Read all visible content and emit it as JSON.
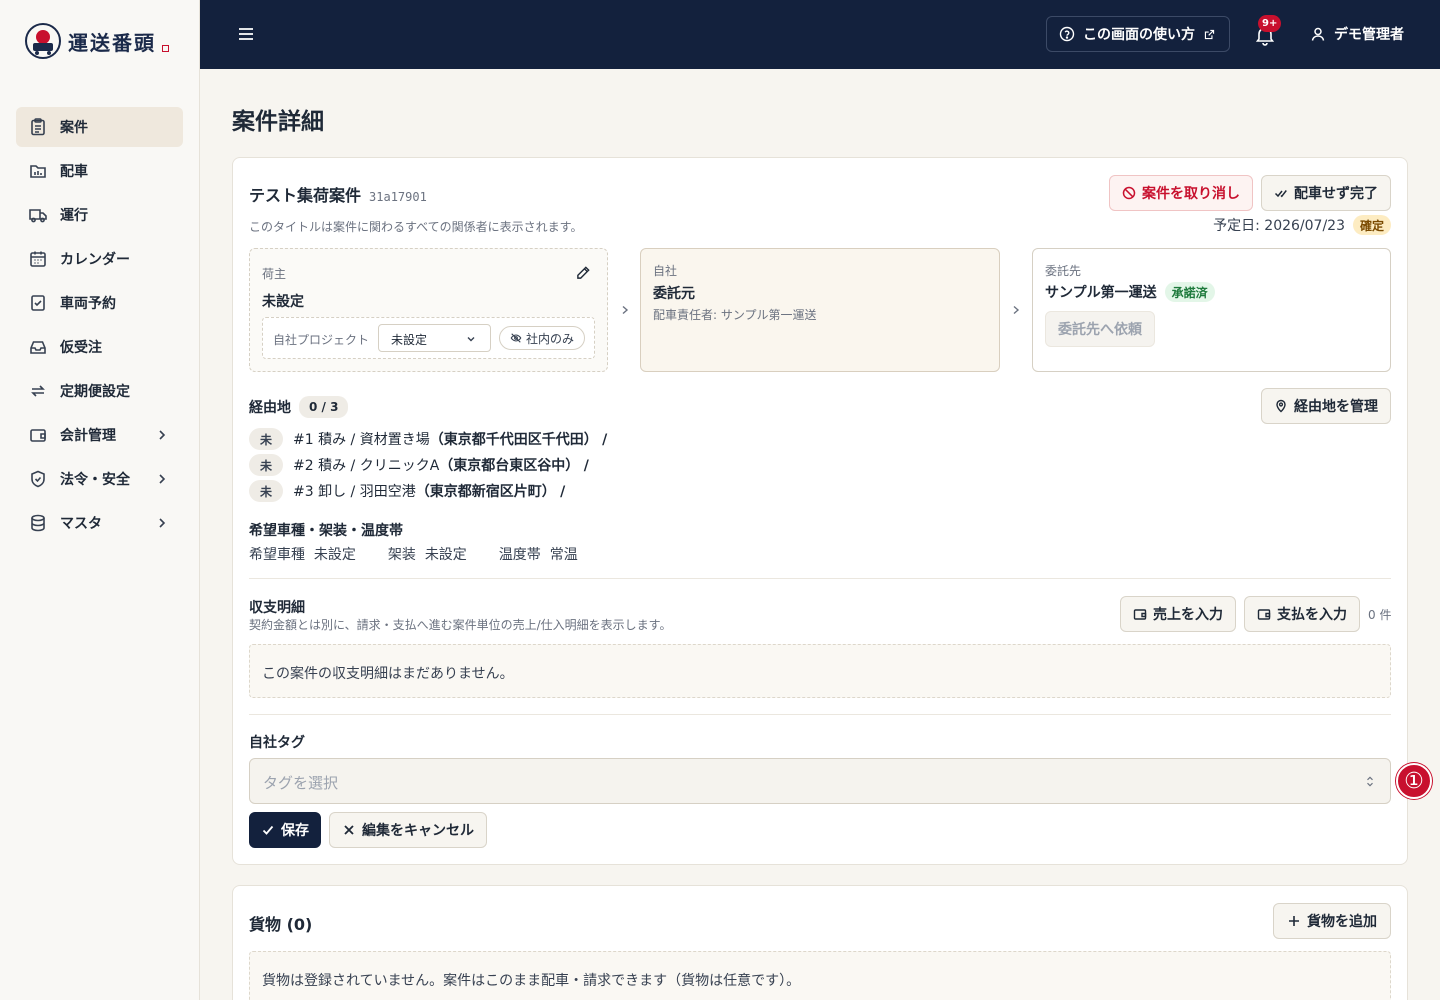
{
  "brand": {
    "name": "運送番頭",
    "colors": {
      "navy": "#13213d",
      "accent_red": "#c8102e"
    }
  },
  "sidebar": {
    "items": [
      {
        "label": "案件",
        "icon": "clipboard-icon",
        "active": true
      },
      {
        "label": "配車",
        "icon": "dispatch-board-icon"
      },
      {
        "label": "運行",
        "icon": "truck-icon"
      },
      {
        "label": "カレンダー",
        "icon": "calendar-icon"
      },
      {
        "label": "車両予約",
        "icon": "reservation-icon"
      },
      {
        "label": "仮受注",
        "icon": "inbox-icon"
      },
      {
        "label": "定期便設定",
        "icon": "repeat-icon"
      },
      {
        "label": "会計管理",
        "icon": "wallet-icon",
        "expandable": true
      },
      {
        "label": "法令・安全",
        "icon": "shield-icon",
        "expandable": true
      },
      {
        "label": "マスタ",
        "icon": "database-icon",
        "expandable": true
      }
    ]
  },
  "header": {
    "help_label": "この画面の使い方",
    "notification_count": "9+",
    "user_name": "デモ管理者"
  },
  "page": {
    "title": "案件詳細"
  },
  "case": {
    "title": "テスト集荷案件",
    "id": "31a17901",
    "title_note": "このタイトルは案件に関わるすべての関係者に表示されます。",
    "cancel_label": "案件を取り消し",
    "complete_label": "配車せず完了",
    "scheduled_label": "予定日: 2026/07/23",
    "status_label": "確定",
    "shipper": {
      "label": "荷主",
      "value": "未設定",
      "project_label": "自社プロジェクト",
      "project_value": "未設定",
      "internal_label": "社内のみ"
    },
    "own": {
      "label": "自社",
      "value": "委託元",
      "manager": "配車責任者: サンプル第一運送"
    },
    "contractor": {
      "label": "委託先",
      "value": "サンプル第一運送",
      "status": "承諾済",
      "request_label": "委託先へ依頼"
    },
    "stops": {
      "label": "経由地",
      "count": "0 / 3",
      "manage_label": "経由地を管理",
      "items": [
        {
          "status": "未",
          "text": "#1 積み / 資材置き場",
          "address": "（東京都千代田区千代田）",
          "suffix": "/"
        },
        {
          "status": "未",
          "text": "#2 積み / クリニックA",
          "address": "（東京都台東区谷中）",
          "suffix": "/"
        },
        {
          "status": "未",
          "text": "#3 卸し / 羽田空港",
          "address": "（東京都新宿区片町）",
          "suffix": "/"
        }
      ]
    },
    "vehicle": {
      "label": "希望車種・架装・温度帯",
      "type_label": "希望車種",
      "type_value": "未設定",
      "body_label": "架装",
      "body_value": "未設定",
      "temp_label": "温度帯",
      "temp_value": "常温"
    },
    "ledger": {
      "label": "収支明細",
      "note": "契約金額とは別に、請求・支払へ進む案件単位の売上/仕入明細を表示します。",
      "sales_label": "売上を入力",
      "payment_label": "支払を入力",
      "count": "0 件",
      "empty": "この案件の収支明細はまだありません。"
    },
    "tags": {
      "label": "自社タグ",
      "placeholder": "タグを選択",
      "annotation": "①"
    },
    "save_label": "保存",
    "cancel_edit_label": "編集をキャンセル"
  },
  "cargo": {
    "title": "貨物 (0)",
    "add_label": "貨物を追加",
    "empty": "貨物は登録されていません。案件はこのまま配車・請求できます（貨物は任意です）。"
  }
}
